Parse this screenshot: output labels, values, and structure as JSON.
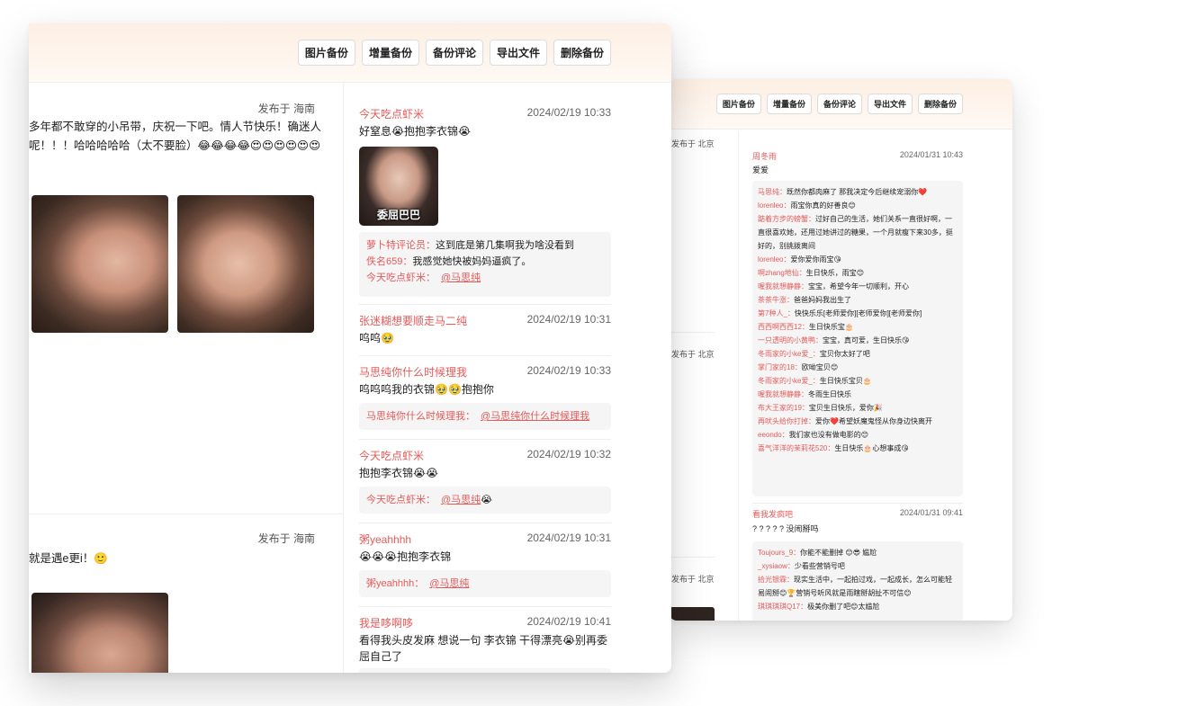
{
  "front": {
    "toolbar": [
      "图片备份",
      "增量备份",
      "备份评论",
      "导出文件",
      "删除备份"
    ],
    "posts": [
      {
        "location": "发布于 海南",
        "text": "多年都不敢穿的小吊带，庆祝一下吧。情人节快乐！确迷人呢！！！哈哈哈哈哈（太不要脸）😂😂😂😂😍😍😍😍😍😍"
      },
      {
        "location": "发布于 海南",
        "text": "就是遇e更i！🙂"
      }
    ],
    "comments": [
      {
        "user": "今天吃点虾米",
        "time": "2024/02/19 10:33",
        "text": "好窒息😭抱抱李衣锦😭",
        "sticker_caption": "委屈巴巴",
        "replies": [
          {
            "name": "萝卜特评论员：",
            "text": "这到底是第几集啊我为啥没看到"
          },
          {
            "name": "佚名659：",
            "text": "我感觉她快被妈妈逼疯了。"
          },
          {
            "name": "今天吃点虾米：",
            "link": "@马思纯"
          }
        ]
      },
      {
        "user": "张迷糊想要顺走马二纯",
        "time": "2024/02/19 10:31",
        "text": "呜呜🥹"
      },
      {
        "user": "马思纯你什么时候理我",
        "time": "2024/02/19 10:33",
        "text": "呜呜呜我的衣锦🥹🥹抱抱你",
        "replies": [
          {
            "name": "马思纯你什么时候理我：",
            "link": "@马思纯你什么时候理我"
          }
        ]
      },
      {
        "user": "今天吃点虾米",
        "time": "2024/02/19 10:32",
        "text": "抱抱李衣锦😭😭",
        "replies": [
          {
            "name": "今天吃点虾米：",
            "link": "@马思纯",
            "tail": "😭"
          }
        ]
      },
      {
        "user": "粥yeahhhh",
        "time": "2024/02/19 10:31",
        "text": "😭😭😭抱抱李衣锦",
        "replies": [
          {
            "name": "粥yeahhhh：",
            "link": "@马思纯"
          }
        ]
      },
      {
        "user": "我是哆啊哆",
        "time": "2024/02/19 10:41",
        "text": "看得我头皮发麻 想说一句 李衣锦 干得漂亮😭别再委屈自己了"
      }
    ]
  },
  "back": {
    "toolbar": [
      "图片备份",
      "增量备份",
      "备份评论",
      "导出文件",
      "删除备份"
    ],
    "locations": [
      "发布于 北京",
      "发布于 北京",
      "发布于 北京"
    ],
    "comments": [
      {
        "user": "周冬雨",
        "time": "2024/01/31 10:43",
        "text": "爱爱",
        "replies": [
          {
            "name": "马思纯：",
            "text": "既然你都肉麻了 那我决定今后继续宠溺你❤️"
          },
          {
            "name": "lorenleo：",
            "text": "雨宝你真的好善良😊"
          },
          {
            "name": "踮着方步的螃蟹：",
            "text": "过好自己的生活，她们关系一直很好啊，一直很喜欢她，还用过她讲过的糖果，一个月就瘦下来30多，挺好的，别挑拨离间"
          },
          {
            "name": "lorenleo：",
            "text": "爱你爱你雨宝😘"
          },
          {
            "name": "啊zhang地仙：",
            "text": "生日快乐，雨宝😊"
          },
          {
            "name": "喔我就想静静：",
            "text": "宝宝，希望今年一切顺利，开心"
          },
          {
            "name": "茶茶牛涨：",
            "text": "爸爸妈妈我出生了"
          },
          {
            "name": "第7种人_：",
            "text": "快快乐乐[老师爱你][老师爱你][老师爱你]"
          },
          {
            "name": "西西啊西西12：",
            "text": "生日快乐宝🎂"
          },
          {
            "name": "一只透明的小黄鸭：",
            "text": "宝宝，真可爱，生日快乐😘"
          },
          {
            "name": "冬雨家的小ke爱_：",
            "text": "宝贝你太好了吧"
          },
          {
            "name": "掌门家的18：",
            "text": "欧呦宝贝😊"
          },
          {
            "name": "冬雨家的小ke爱_：",
            "text": "生日快乐宝贝🎂"
          },
          {
            "name": "喔我就想静静：",
            "text": "冬雨生日快乐"
          },
          {
            "name": "布大王家的19：",
            "text": "宝贝生日快乐，爱你🎉"
          },
          {
            "name": "再吠头给你打掉：",
            "text": "爱你❤️希望妖魔鬼怪从你身边快离开"
          },
          {
            "name": "eeondo：",
            "text": "我们家也没有做电影的😊"
          },
          {
            "name": "喜气洋洋的茉莉花520：",
            "text": "生日快乐🎂心想事成😘"
          }
        ]
      },
      {
        "user": "看我发疯吧",
        "time": "2024/01/31 09:41",
        "text": "? ? ? ? ? 没闹掰吗",
        "replies": [
          {
            "name": "Toujours_9：",
            "text": "你能不能删掉 😊😎 尴尬"
          },
          {
            "name": "_xysiaow：",
            "text": "少看些营销号吧"
          },
          {
            "name": "拾光银霖：",
            "text": "现实生活中，一起拍过戏，一起成长，怎么可能轻易闹掰😊🏆营销号听风就是雨瞎掰胡扯不可信😊"
          },
          {
            "name": "琪琪琪琪Q17：",
            "text": "极美你删了吧😊太尴尬"
          }
        ]
      }
    ]
  }
}
